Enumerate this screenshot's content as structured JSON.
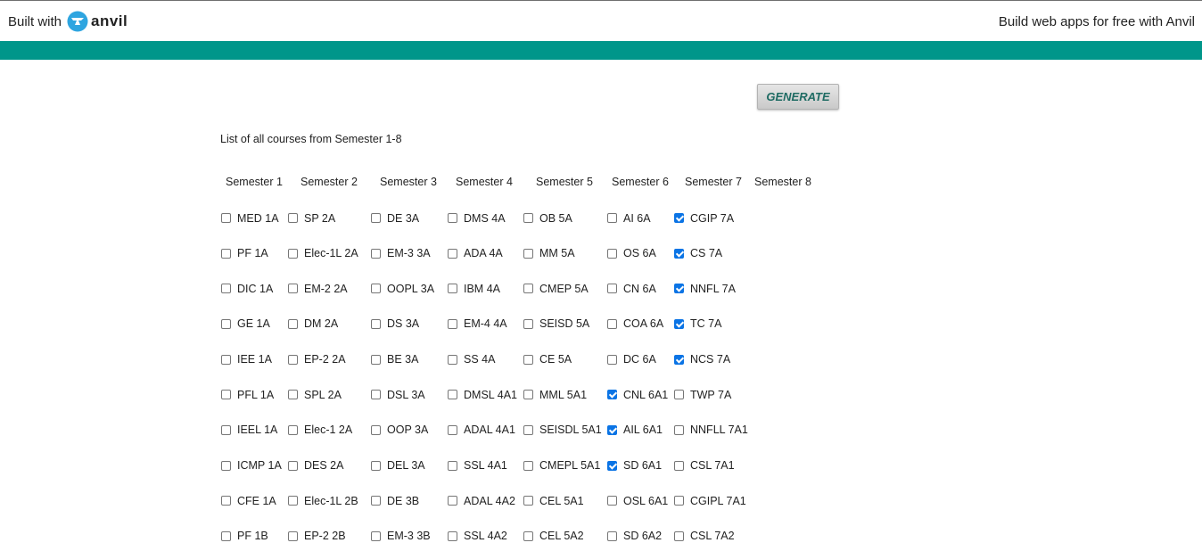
{
  "header": {
    "built_with": "Built with",
    "logo_word": "anvil",
    "promo": "Build web apps for free with Anvil"
  },
  "colors": {
    "accent_bar": "#00968a",
    "checkbox_checked": "#0b74e5"
  },
  "generate_label": "GENERATE",
  "intro_text": "List of all courses from Semester 1-8",
  "semesters": [
    {
      "label": "Semester 1",
      "courses": [
        {
          "name": "MED 1A",
          "checked": false
        },
        {
          "name": "PF 1A",
          "checked": false
        },
        {
          "name": "DIC 1A",
          "checked": false
        },
        {
          "name": "GE 1A",
          "checked": false
        },
        {
          "name": "IEE 1A",
          "checked": false
        },
        {
          "name": "PFL 1A",
          "checked": false
        },
        {
          "name": "IEEL 1A",
          "checked": false
        },
        {
          "name": "ICMP 1A",
          "checked": false
        },
        {
          "name": "CFE 1A",
          "checked": false
        },
        {
          "name": "PF 1B",
          "checked": false
        }
      ]
    },
    {
      "label": "Semester 2",
      "courses": [
        {
          "name": "SP 2A",
          "checked": false
        },
        {
          "name": "Elec-1L 2A",
          "checked": false
        },
        {
          "name": "EM-2 2A",
          "checked": false
        },
        {
          "name": "DM 2A",
          "checked": false
        },
        {
          "name": "EP-2 2A",
          "checked": false
        },
        {
          "name": "SPL 2A",
          "checked": false
        },
        {
          "name": "Elec-1 2A",
          "checked": false
        },
        {
          "name": "DES 2A",
          "checked": false
        },
        {
          "name": "Elec-1L 2B",
          "checked": false
        },
        {
          "name": "EP-2 2B",
          "checked": false
        }
      ]
    },
    {
      "label": "Semester 3",
      "courses": [
        {
          "name": "DE 3A",
          "checked": false
        },
        {
          "name": "EM-3 3A",
          "checked": false
        },
        {
          "name": "OOPL 3A",
          "checked": false
        },
        {
          "name": "DS 3A",
          "checked": false
        },
        {
          "name": "BE 3A",
          "checked": false
        },
        {
          "name": "DSL 3A",
          "checked": false
        },
        {
          "name": "OOP 3A",
          "checked": false
        },
        {
          "name": "DEL 3A",
          "checked": false
        },
        {
          "name": "DE 3B",
          "checked": false
        },
        {
          "name": "EM-3 3B",
          "checked": false
        }
      ]
    },
    {
      "label": "Semester 4",
      "courses": [
        {
          "name": "DMS 4A",
          "checked": false
        },
        {
          "name": "ADA 4A",
          "checked": false
        },
        {
          "name": "IBM 4A",
          "checked": false
        },
        {
          "name": "EM-4 4A",
          "checked": false
        },
        {
          "name": "SS 4A",
          "checked": false
        },
        {
          "name": "DMSL 4A1",
          "checked": false
        },
        {
          "name": "ADAL 4A1",
          "checked": false
        },
        {
          "name": "SSL 4A1",
          "checked": false
        },
        {
          "name": "ADAL 4A2",
          "checked": false
        },
        {
          "name": "SSL 4A2",
          "checked": false
        }
      ]
    },
    {
      "label": "Semester 5",
      "courses": [
        {
          "name": "OB 5A",
          "checked": false
        },
        {
          "name": "MM 5A",
          "checked": false
        },
        {
          "name": "CMEP 5A",
          "checked": false
        },
        {
          "name": "SEISD 5A",
          "checked": false
        },
        {
          "name": "CE 5A",
          "checked": false
        },
        {
          "name": "MML 5A1",
          "checked": false
        },
        {
          "name": "SEISDL 5A1",
          "checked": false
        },
        {
          "name": "CMEPL 5A1",
          "checked": false
        },
        {
          "name": "CEL 5A1",
          "checked": false
        },
        {
          "name": "CEL 5A2",
          "checked": false
        }
      ]
    },
    {
      "label": "Semester 6",
      "courses": [
        {
          "name": "AI 6A",
          "checked": false
        },
        {
          "name": "OS 6A",
          "checked": false
        },
        {
          "name": "CN 6A",
          "checked": false
        },
        {
          "name": "COA 6A",
          "checked": false
        },
        {
          "name": "DC 6A",
          "checked": false
        },
        {
          "name": "CNL 6A1",
          "checked": true
        },
        {
          "name": "AIL 6A1",
          "checked": true
        },
        {
          "name": "SD 6A1",
          "checked": true
        },
        {
          "name": "OSL 6A1",
          "checked": false
        },
        {
          "name": "SD 6A2",
          "checked": false
        }
      ]
    },
    {
      "label": "Semester 7",
      "courses": [
        {
          "name": "CGIP 7A",
          "checked": true
        },
        {
          "name": "CS 7A",
          "checked": true
        },
        {
          "name": "NNFL 7A",
          "checked": true
        },
        {
          "name": "TC 7A",
          "checked": true
        },
        {
          "name": "NCS 7A",
          "checked": true
        },
        {
          "name": "TWP 7A",
          "checked": false
        },
        {
          "name": "NNFLL 7A1",
          "checked": false
        },
        {
          "name": "CSL 7A1",
          "checked": false
        },
        {
          "name": "CGIPL 7A1",
          "checked": false
        },
        {
          "name": "CSL 7A2",
          "checked": false
        }
      ]
    },
    {
      "label": "Semester 8",
      "courses": []
    }
  ]
}
